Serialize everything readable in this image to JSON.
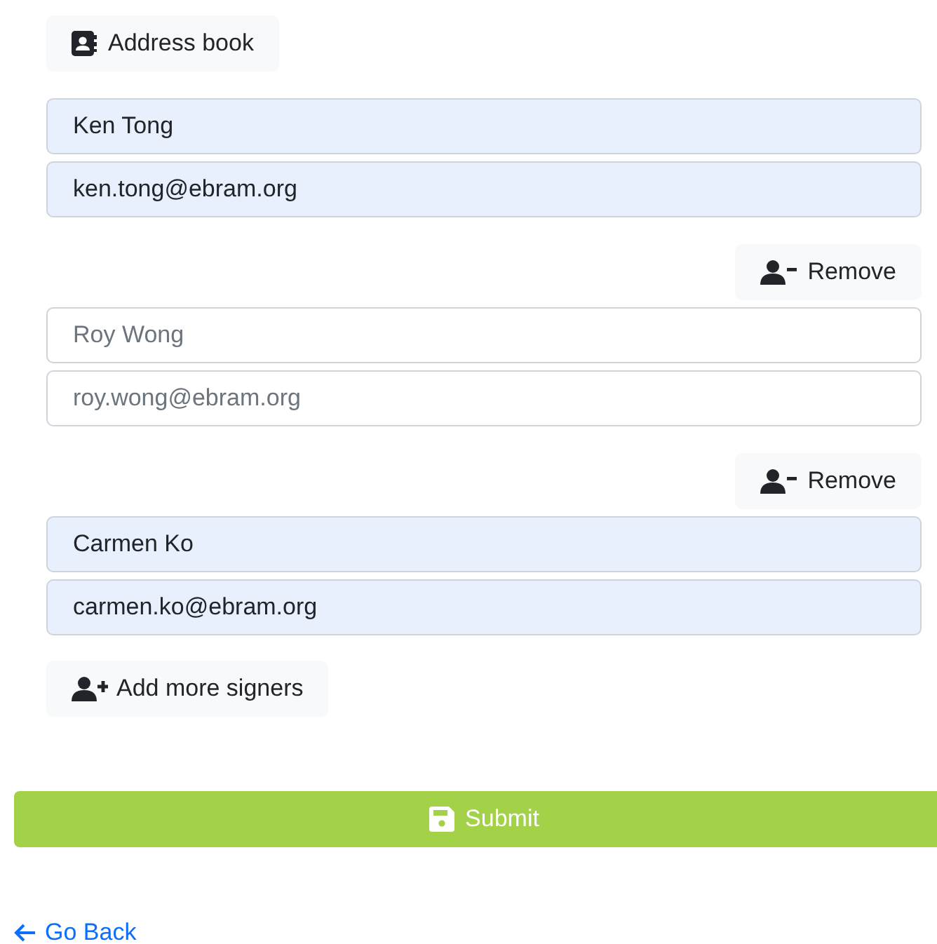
{
  "address_book_button": "Address book",
  "signers": [
    {
      "name": {
        "value": "Ken Tong",
        "autofilled": true
      },
      "email": {
        "value": "ken.tong@ebram.org",
        "autofilled": true
      }
    },
    {
      "remove_button": "Remove",
      "name": {
        "placeholder": "Roy Wong",
        "autofilled": false
      },
      "email": {
        "placeholder": "roy.wong@ebram.org",
        "autofilled": false
      }
    },
    {
      "remove_button": "Remove",
      "name": {
        "value": "Carmen Ko",
        "autofilled": true
      },
      "email": {
        "value": "carmen.ko@ebram.org",
        "autofilled": true
      }
    }
  ],
  "add_signers_button": "Add more signers",
  "submit_button": "Submit",
  "go_back_link": "Go Back"
}
